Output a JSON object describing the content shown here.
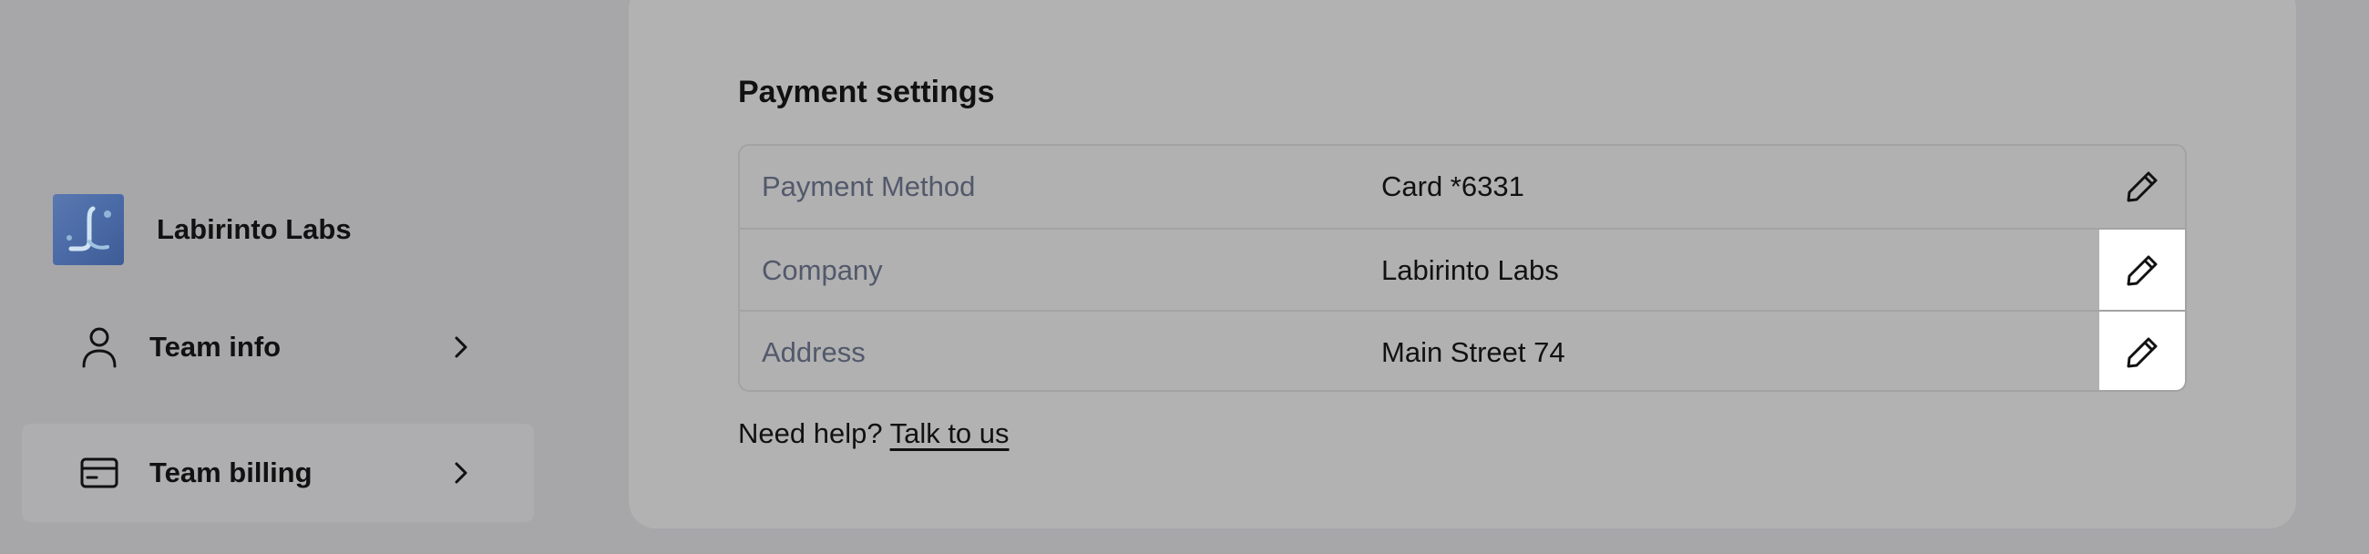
{
  "sidebar": {
    "team_name": "Labirinto Labs",
    "items": [
      {
        "label": "Team info",
        "icon": "user-icon",
        "active": false
      },
      {
        "label": "Team billing",
        "icon": "credit-card-icon",
        "active": true
      }
    ]
  },
  "main": {
    "section_title": "Payment settings",
    "rows": [
      {
        "label": "Payment Method",
        "value": "Card *6331"
      },
      {
        "label": "Company",
        "value": "Labirinto Labs"
      },
      {
        "label": "Address",
        "value": "Main Street 74"
      }
    ],
    "help": {
      "text": "Need help?",
      "link": "Talk to us"
    }
  },
  "colors": {
    "background": "#a7a7aa",
    "card": "#b2b2b2",
    "label_text": "#52596b",
    "highlight": "#ffffff"
  }
}
